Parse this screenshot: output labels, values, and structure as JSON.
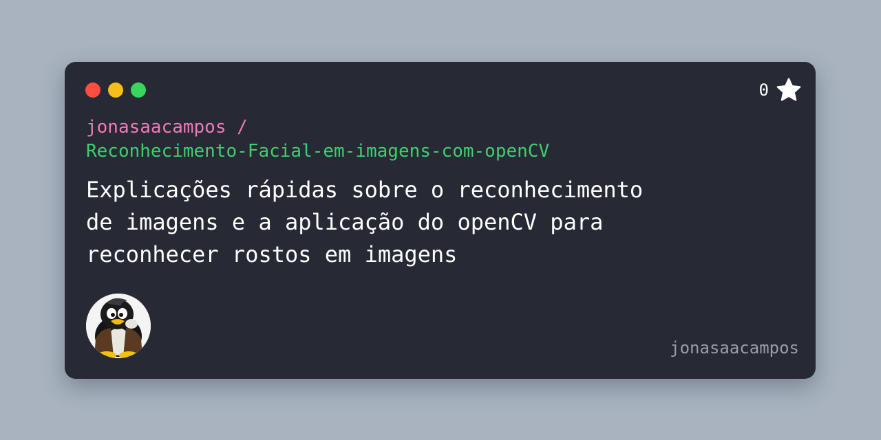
{
  "window": {
    "dots": [
      {
        "name": "close-dot",
        "color": "#ff4d3e"
      },
      {
        "name": "minimize-dot",
        "color": "#f8bd1a"
      },
      {
        "name": "maximize-dot",
        "color": "#3ad55d"
      }
    ]
  },
  "stars": {
    "count": "0",
    "icon": "star-icon"
  },
  "repo": {
    "owner": "jonasaacampos /",
    "name": "Reconhecimento-Facial-em-imagens-com-openCV",
    "owner_color": "#f07ab8",
    "name_color": "#3ecf6e"
  },
  "description": {
    "lines": [
      "Explicações rápidas sobre o reconhecimento",
      "de imagens e a aplicação do openCV para",
      "reconhecer rostos em imagens"
    ]
  },
  "avatar": {
    "icon": "penguin-avatar-icon"
  },
  "username": "jonasaacampos",
  "colors": {
    "background": "#a8b3bf",
    "card": "#272935",
    "text": "#ffffff",
    "muted": "#9a9ca6"
  }
}
